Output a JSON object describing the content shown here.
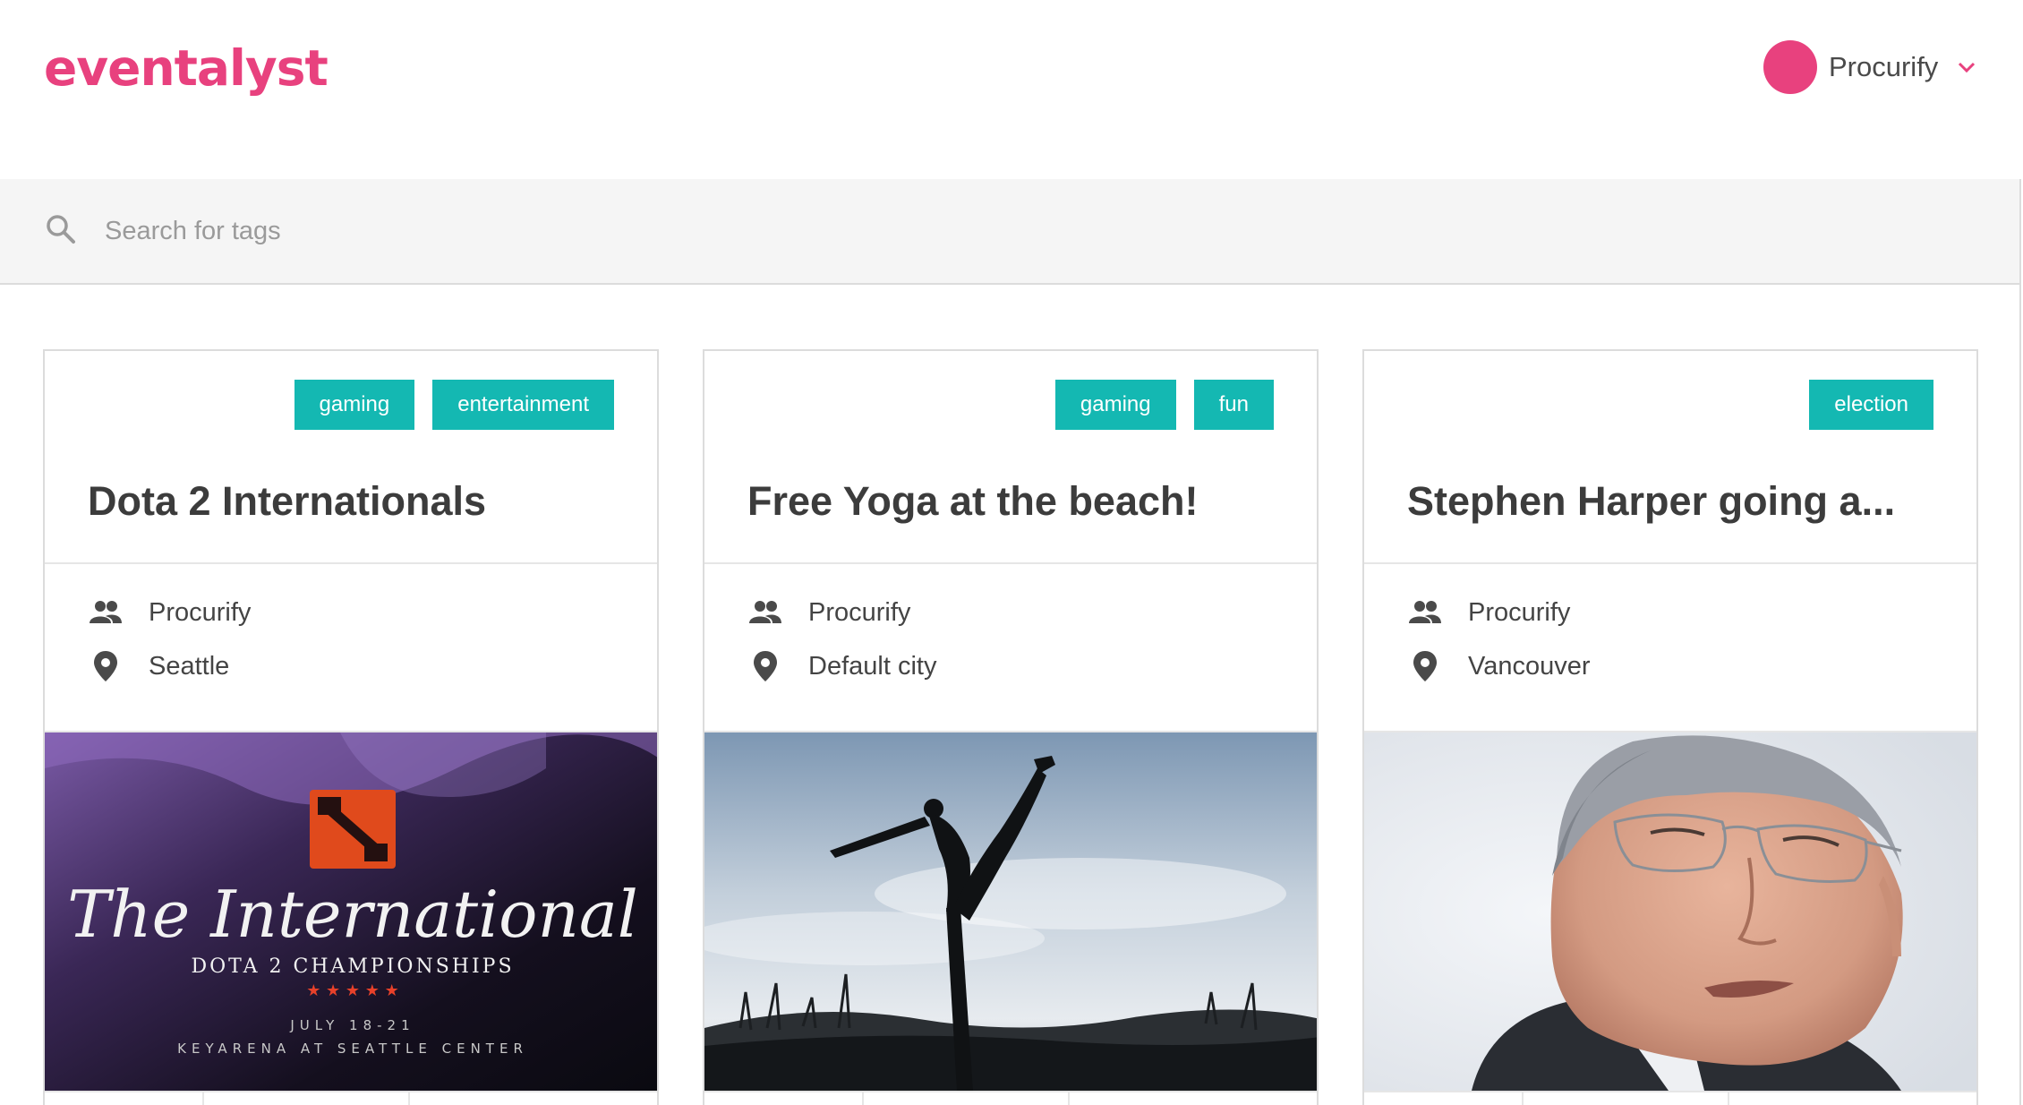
{
  "app": {
    "logo": "eventalyst"
  },
  "user": {
    "name": "Procurify",
    "avatar_color": "#e8417e"
  },
  "search": {
    "placeholder": "Search for tags",
    "value": ""
  },
  "colors": {
    "brand": "#e8417e",
    "tag": "#14b8b2",
    "border": "#dcdcdc"
  },
  "cards": [
    {
      "tags": [
        "gaming",
        "entertainment"
      ],
      "title": "Dota 2 Internationals",
      "organizer": "Procurify",
      "location": "Seattle",
      "image": {
        "type": "event-poster",
        "logo_text": "The International",
        "subtitle": "DOTA 2 CHAMPIONSHIPS",
        "stars": "★ ★ ★ ★ ★",
        "dates": "JULY 18-21",
        "venue": "KEYARENA AT SEATTLE CENTER"
      }
    },
    {
      "tags": [
        "gaming",
        "fun"
      ],
      "title": "Free Yoga at the beach!",
      "organizer": "Procurify",
      "location": "Default city",
      "image": {
        "type": "photo-yoga-silhouette"
      }
    },
    {
      "tags": [
        "election"
      ],
      "title": "Stephen Harper going a...",
      "organizer": "Procurify",
      "location": "Vancouver",
      "image": {
        "type": "photo-portrait"
      }
    }
  ]
}
